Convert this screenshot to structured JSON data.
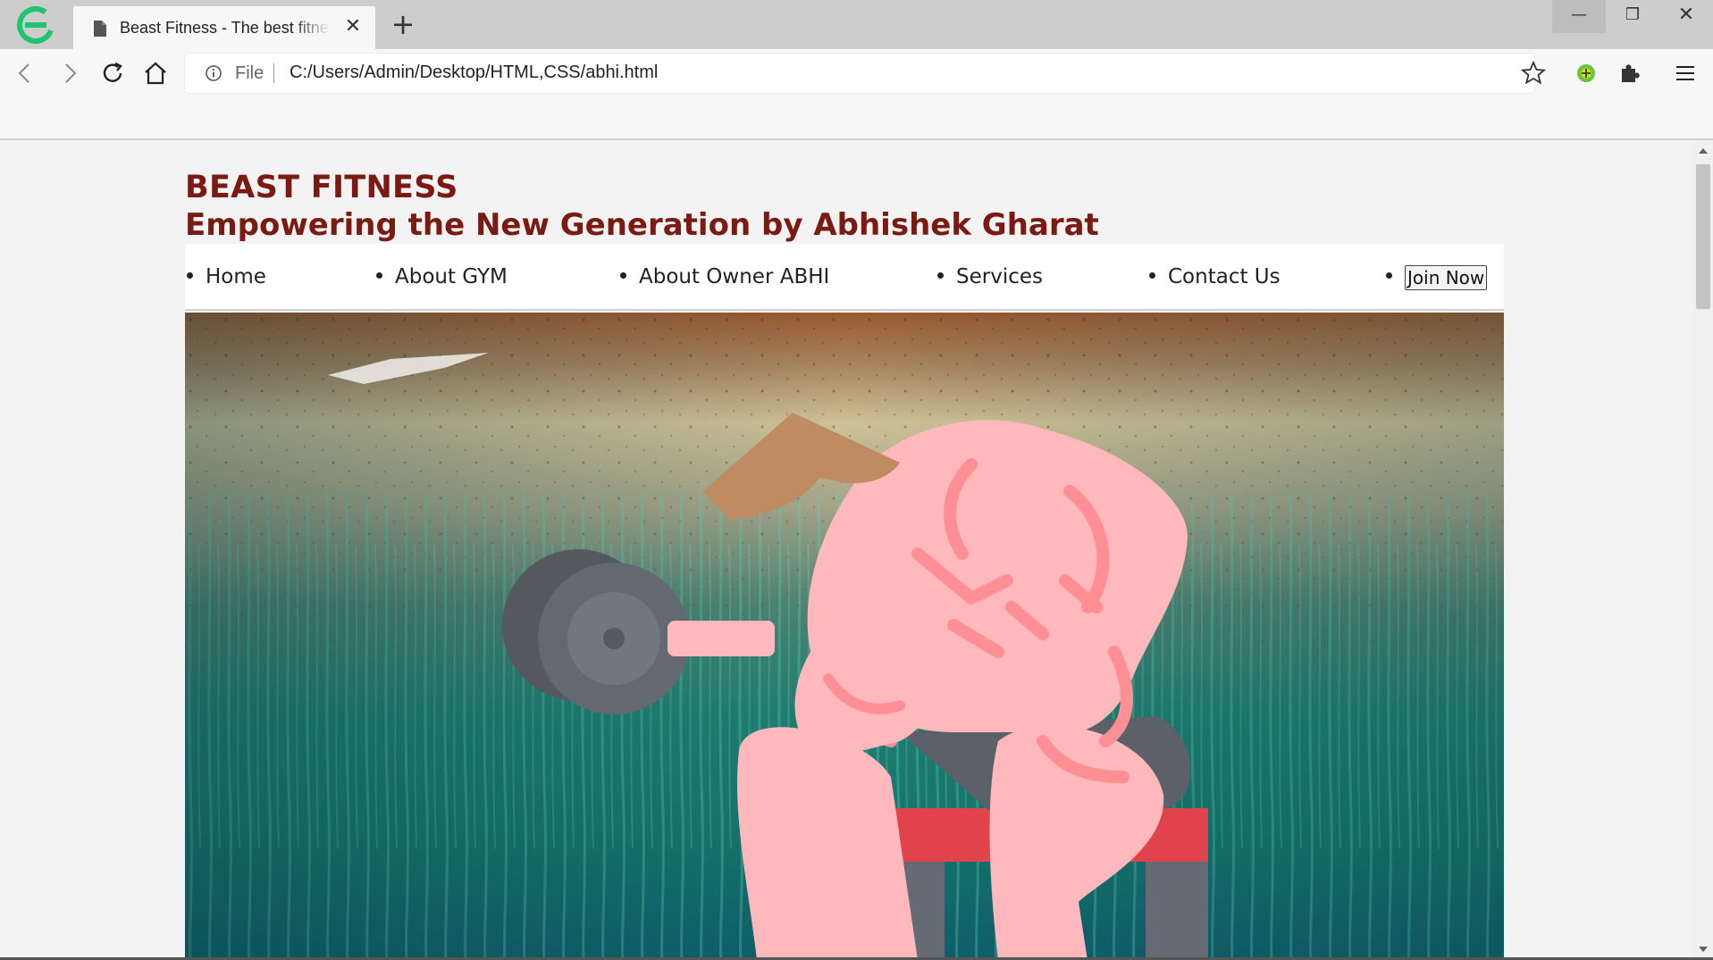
{
  "browser": {
    "tab_title": "Beast Fitness - The best fitness",
    "tab_close": "✕",
    "new_tab": "+",
    "address_scheme": "File",
    "address_url": "C:/Users/Admin/Desktop/HTML,CSS/abhi.html",
    "window_controls": {
      "minimize": "—",
      "maximize": "❐",
      "close": "✕"
    }
  },
  "page": {
    "title": "BEAST FITNESS",
    "tagline": "Empowering the New Generation by Abhishek Gharat",
    "nav": {
      "items": [
        {
          "label": "Home"
        },
        {
          "label": "About GYM"
        },
        {
          "label": "About Owner ABHI"
        },
        {
          "label": "Services"
        },
        {
          "label": "Contact Us"
        }
      ],
      "join_label": "Join Now"
    }
  },
  "colors": {
    "heading": "#7a1a12",
    "navbar_bg": "#ffffff",
    "page_bg": "#f3f3f3",
    "tabstrip_bg": "#cdcdcd"
  }
}
